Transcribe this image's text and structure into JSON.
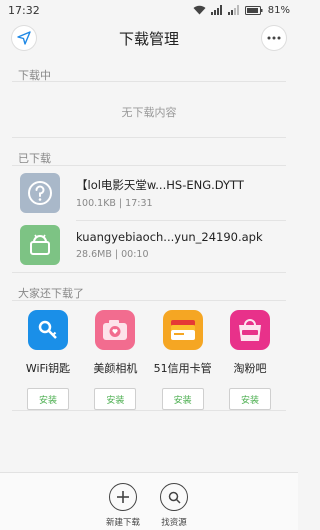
{
  "status": {
    "time": "17:32",
    "battery": "81%"
  },
  "header": {
    "title": "下载管理"
  },
  "downloading": {
    "label": "下载中",
    "empty_text": "无下载内容"
  },
  "downloaded": {
    "label": "已下载",
    "items": [
      {
        "name": "【lol电影天堂w...HS-ENG.DYTT",
        "meta": "100.1KB | 17:31",
        "icon": "unknown-file-icon"
      },
      {
        "name": "kuangyebiaoch...yun_24190.apk",
        "meta": "28.6MB | 00:10",
        "icon": "android-apk-icon"
      }
    ]
  },
  "recommend": {
    "label": "大家还下载了",
    "install_label": "安装",
    "apps": [
      {
        "name": "WiFi钥匙",
        "icon": "wifi-key-icon",
        "color": "#1a8fe8"
      },
      {
        "name": "美颜相机",
        "icon": "beauty-camera-icon",
        "color": "#f26c8f"
      },
      {
        "name": "51信用卡管",
        "icon": "credit-card-icon",
        "color": "#f5a623"
      },
      {
        "name": "淘粉吧",
        "icon": "taofenba-icon",
        "color": "#e8318a"
      }
    ]
  },
  "bottom": {
    "new_download": "新建下载",
    "find_resource": "找资源"
  },
  "colors": {
    "accent": "#4caf50",
    "file_unknown": "#a9b8c9",
    "file_apk": "#7dc384"
  }
}
